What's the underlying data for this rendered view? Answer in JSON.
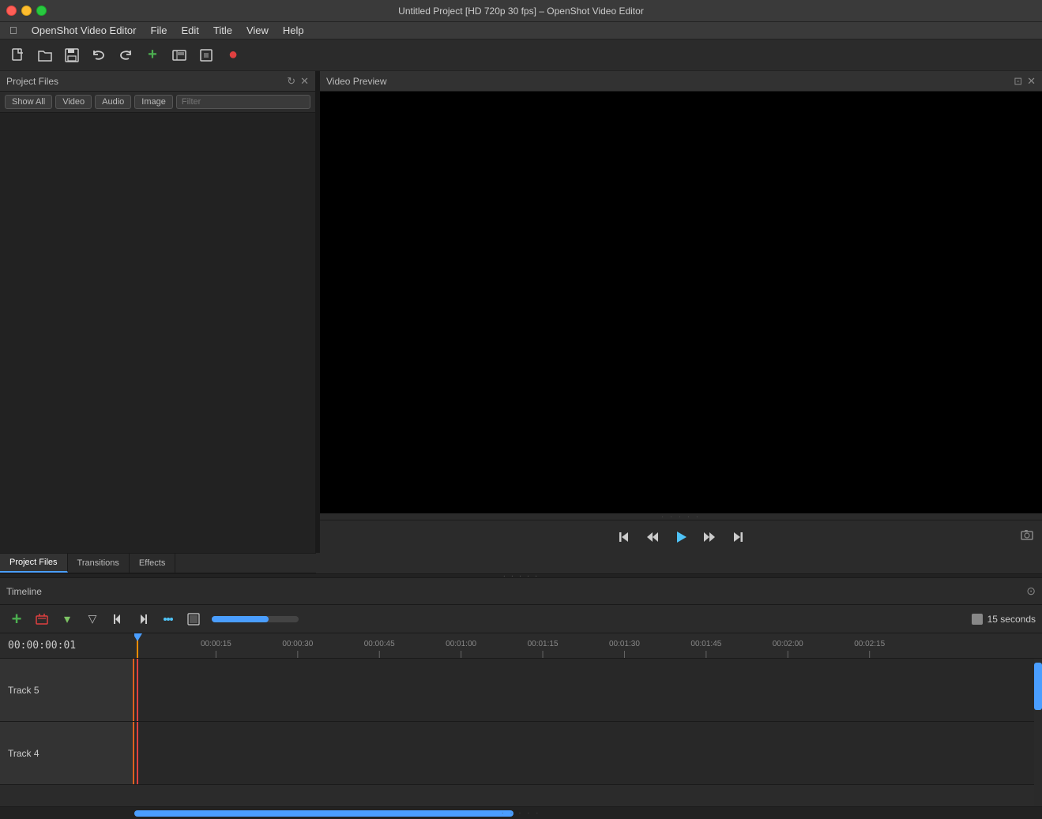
{
  "app": {
    "title": "Untitled Project [HD 720p 30 fps] – OpenShot Video Editor",
    "name": "OpenShot Video Editor"
  },
  "titlebar": {
    "close_label": "",
    "minimize_label": "",
    "maximize_label": ""
  },
  "menubar": {
    "items": [
      {
        "id": "apple",
        "label": ""
      },
      {
        "id": "file",
        "label": "File"
      },
      {
        "id": "edit",
        "label": "Edit"
      },
      {
        "id": "title",
        "label": "Title"
      },
      {
        "id": "view",
        "label": "View"
      },
      {
        "id": "help",
        "label": "Help"
      }
    ]
  },
  "toolbar": {
    "buttons": [
      {
        "id": "new",
        "icon": "📄",
        "label": "New"
      },
      {
        "id": "open",
        "icon": "📂",
        "label": "Open"
      },
      {
        "id": "save",
        "icon": "💾",
        "label": "Save"
      },
      {
        "id": "undo",
        "icon": "↩",
        "label": "Undo"
      },
      {
        "id": "redo",
        "icon": "↪",
        "label": "Redo"
      },
      {
        "id": "add",
        "icon": "+",
        "label": "Add"
      },
      {
        "id": "preview",
        "icon": "▦",
        "label": "Preview"
      },
      {
        "id": "fullscreen",
        "icon": "⊞",
        "label": "Fullscreen"
      },
      {
        "id": "record",
        "icon": "●",
        "label": "Record"
      }
    ]
  },
  "project_files_panel": {
    "title": "Project Files",
    "filter_tabs": [
      {
        "id": "show_all",
        "label": "Show All"
      },
      {
        "id": "video",
        "label": "Video"
      },
      {
        "id": "audio",
        "label": "Audio"
      },
      {
        "id": "image",
        "label": "Image"
      }
    ],
    "filter_placeholder": "Filter"
  },
  "video_preview_panel": {
    "title": "Video Preview"
  },
  "bottom_tabs": [
    {
      "id": "project_files",
      "label": "Project Files",
      "active": true
    },
    {
      "id": "transitions",
      "label": "Transitions"
    },
    {
      "id": "effects",
      "label": "Effects"
    }
  ],
  "playback": {
    "jump_start": "⏮",
    "rewind": "⏪",
    "play": "▶",
    "fast_forward": "⏩",
    "jump_end": "⏭"
  },
  "timeline": {
    "title": "Timeline",
    "time_display": "00:00:00:01",
    "seconds_label": "15 seconds",
    "toolbar_buttons": [
      {
        "id": "add_track",
        "icon": "+",
        "color": "green"
      },
      {
        "id": "remove",
        "icon": "⊟",
        "color": "red"
      },
      {
        "id": "dropdown",
        "icon": "▾"
      },
      {
        "id": "filter",
        "icon": "▽"
      },
      {
        "id": "jump_start",
        "icon": "⏮"
      },
      {
        "id": "jump_end",
        "icon": "⏭"
      },
      {
        "id": "snap",
        "icon": "⋯"
      },
      {
        "id": "razor",
        "icon": "⊡"
      }
    ],
    "ruler_marks": [
      {
        "label": "00:00:15",
        "pos_pct": 9
      },
      {
        "label": "00:00:30",
        "pos_pct": 18
      },
      {
        "label": "00:00:45",
        "pos_pct": 27
      },
      {
        "label": "00:01:00",
        "pos_pct": 36
      },
      {
        "label": "00:01:15",
        "pos_pct": 45
      },
      {
        "label": "00:01:30",
        "pos_pct": 54
      },
      {
        "label": "00:01:45",
        "pos_pct": 63
      },
      {
        "label": "00:02:00",
        "pos_pct": 72
      },
      {
        "label": "00:02:15",
        "pos_pct": 81
      }
    ],
    "tracks": [
      {
        "id": "track5",
        "label": "Track 5"
      },
      {
        "id": "track4",
        "label": "Track 4"
      }
    ]
  }
}
